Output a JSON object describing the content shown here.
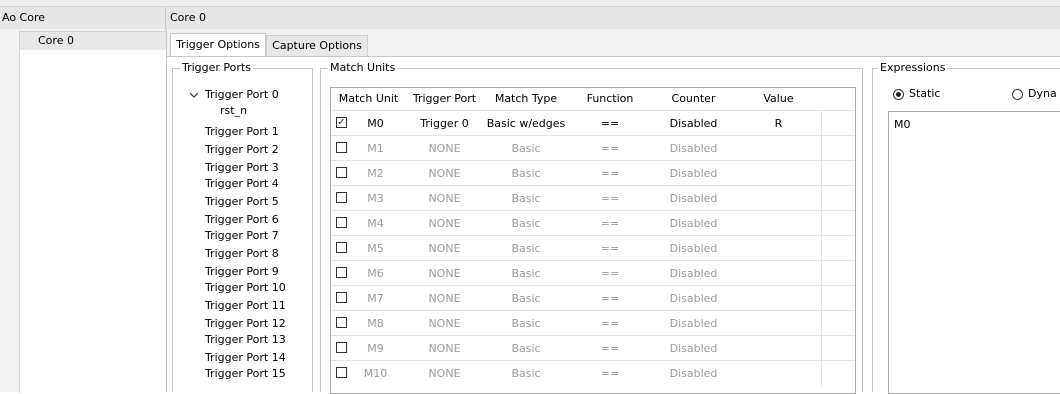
{
  "header": {
    "left_title": "Ao Core",
    "right_title": "Core 0"
  },
  "tree": {
    "items": [
      "Core 0"
    ]
  },
  "tabs": [
    {
      "label": "Trigger Options",
      "active": true
    },
    {
      "label": "Capture Options",
      "active": false
    }
  ],
  "trigger_ports": {
    "title": "Trigger Ports",
    "expanded_port": "Trigger Port 0",
    "child": "rst_n",
    "ports": [
      "Trigger Port 1",
      "Trigger Port 2",
      "Trigger Port 3",
      "Trigger Port 4",
      "Trigger Port 5",
      "Trigger Port 6",
      "Trigger Port 7",
      "Trigger Port 8",
      "Trigger Port 9",
      "Trigger Port 10",
      "Trigger Port 11",
      "Trigger Port 12",
      "Trigger Port 13",
      "Trigger Port 14",
      "Trigger Port 15"
    ]
  },
  "match_units": {
    "title": "Match Units",
    "columns": [
      "Match Unit",
      "Trigger Port",
      "Match Type",
      "Function",
      "Counter",
      "Value"
    ],
    "rows": [
      {
        "checked": true,
        "unit": "M0",
        "port": "Trigger 0",
        "type": "Basic w/edges",
        "func": "==",
        "counter": "Disabled",
        "value": "R"
      },
      {
        "checked": false,
        "unit": "M1",
        "port": "NONE",
        "type": "Basic",
        "func": "==",
        "counter": "Disabled",
        "value": ""
      },
      {
        "checked": false,
        "unit": "M2",
        "port": "NONE",
        "type": "Basic",
        "func": "==",
        "counter": "Disabled",
        "value": ""
      },
      {
        "checked": false,
        "unit": "M3",
        "port": "NONE",
        "type": "Basic",
        "func": "==",
        "counter": "Disabled",
        "value": ""
      },
      {
        "checked": false,
        "unit": "M4",
        "port": "NONE",
        "type": "Basic",
        "func": "==",
        "counter": "Disabled",
        "value": ""
      },
      {
        "checked": false,
        "unit": "M5",
        "port": "NONE",
        "type": "Basic",
        "func": "==",
        "counter": "Disabled",
        "value": ""
      },
      {
        "checked": false,
        "unit": "M6",
        "port": "NONE",
        "type": "Basic",
        "func": "==",
        "counter": "Disabled",
        "value": ""
      },
      {
        "checked": false,
        "unit": "M7",
        "port": "NONE",
        "type": "Basic",
        "func": "==",
        "counter": "Disabled",
        "value": ""
      },
      {
        "checked": false,
        "unit": "M8",
        "port": "NONE",
        "type": "Basic",
        "func": "==",
        "counter": "Disabled",
        "value": ""
      },
      {
        "checked": false,
        "unit": "M9",
        "port": "NONE",
        "type": "Basic",
        "func": "==",
        "counter": "Disabled",
        "value": ""
      },
      {
        "checked": false,
        "unit": "M10",
        "port": "NONE",
        "type": "Basic",
        "func": "==",
        "counter": "Disabled",
        "value": ""
      }
    ]
  },
  "expressions": {
    "title": "Expressions",
    "static_label": "Static",
    "dynamic_label": "Dyna",
    "mode": "static",
    "text": "M0"
  },
  "icons": {
    "expand": "chevron-down-icon",
    "checkbox": "checkbox-icon"
  }
}
